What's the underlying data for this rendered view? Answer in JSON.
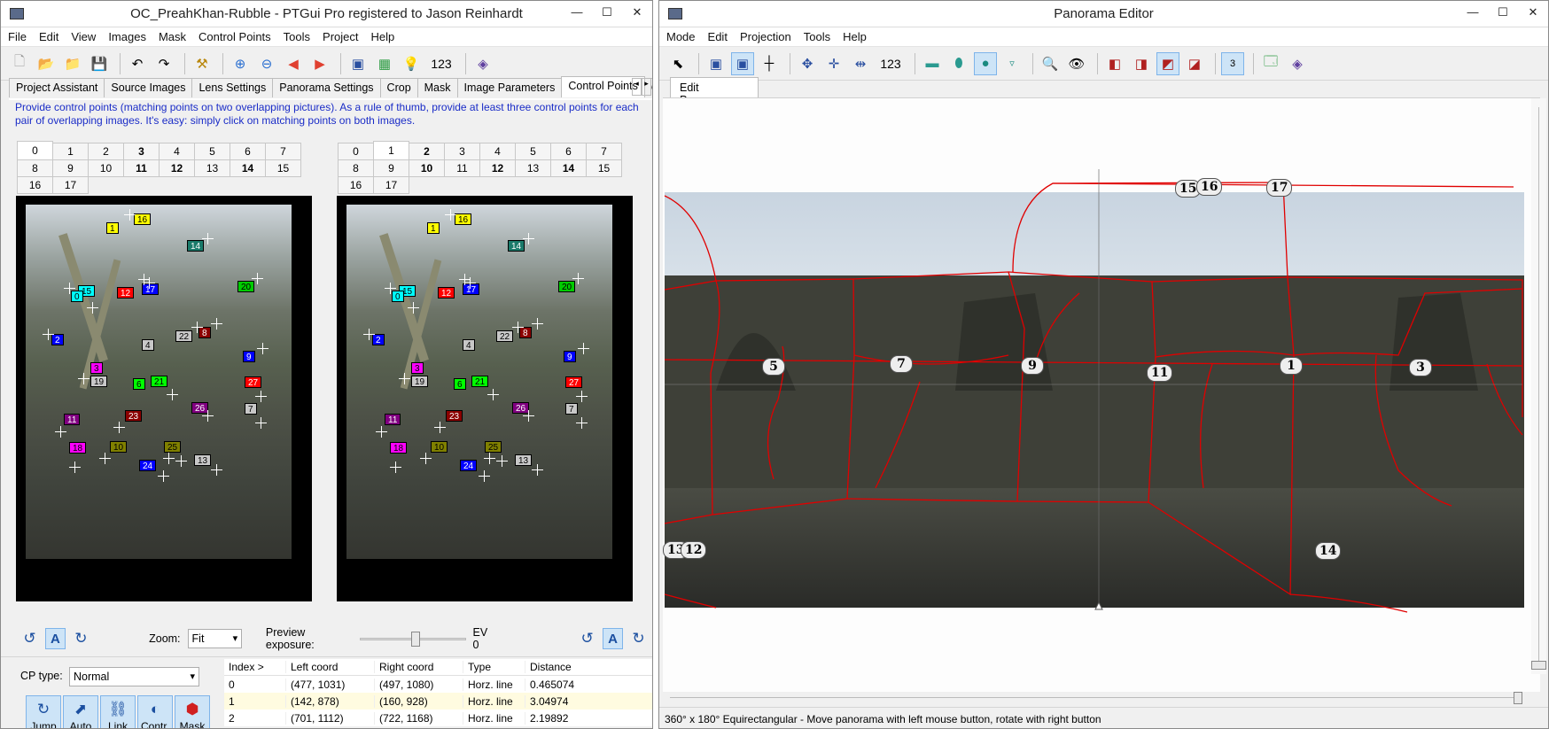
{
  "left_window": {
    "title": "OC_PreahKhan-Rubble - PTGui Pro registered to Jason Reinhardt",
    "menu": [
      "File",
      "Edit",
      "View",
      "Images",
      "Mask",
      "Control Points",
      "Tools",
      "Project",
      "Help"
    ],
    "toolbar_number_label": "123",
    "tabs": [
      "Project Assistant",
      "Source Images",
      "Lens Settings",
      "Panorama Settings",
      "Crop",
      "Mask",
      "Image Parameters",
      "Control Points",
      "O"
    ],
    "active_tab": "Control Points",
    "info_text": "Provide control points (matching points on two overlapping pictures). As a rule of thumb, provide at least three control points for each pair of overlapping images. It's easy: simply click on matching points on both images.",
    "left_image_numbers": [
      "0",
      "1",
      "2",
      "3",
      "4",
      "5",
      "6",
      "7",
      "8",
      "9",
      "10",
      "11",
      "12",
      "13",
      "14",
      "15",
      "16",
      "17"
    ],
    "left_selected": "0",
    "left_bold": [
      "3",
      "11",
      "12",
      "14"
    ],
    "right_image_numbers": [
      "0",
      "1",
      "2",
      "3",
      "4",
      "5",
      "6",
      "7",
      "8",
      "9",
      "10",
      "11",
      "12",
      "13",
      "14",
      "15",
      "16",
      "17"
    ],
    "right_selected": "1",
    "right_bold": [
      "2",
      "10",
      "12",
      "14"
    ],
    "control_points": [
      {
        "label": "1",
        "color": "#ffff00"
      },
      {
        "label": "16",
        "color": "#ffff00"
      },
      {
        "label": "14",
        "color": "#1a7a6a"
      },
      {
        "label": "15",
        "color": "#00ffff"
      },
      {
        "label": "0",
        "color": "#00ffff"
      },
      {
        "label": "12",
        "color": "#ff0000"
      },
      {
        "label": "17",
        "color": "#0000ff"
      },
      {
        "label": "20",
        "color": "#00cc00"
      },
      {
        "label": "2",
        "color": "#0000ff"
      },
      {
        "label": "22",
        "color": "#c8c8c8"
      },
      {
        "label": "8",
        "color": "#8b0000"
      },
      {
        "label": "4",
        "color": "#c8c8c8"
      },
      {
        "label": "9",
        "color": "#0000ff"
      },
      {
        "label": "3",
        "color": "#ff00ff"
      },
      {
        "label": "19",
        "color": "#c8c8c8"
      },
      {
        "label": "6",
        "color": "#00ff00"
      },
      {
        "label": "21",
        "color": "#00ff00"
      },
      {
        "label": "27",
        "color": "#ff0000"
      },
      {
        "label": "26",
        "color": "#800080"
      },
      {
        "label": "7",
        "color": "#c8c8c8"
      },
      {
        "label": "23",
        "color": "#8b0000"
      },
      {
        "label": "11",
        "color": "#800080"
      },
      {
        "label": "18",
        "color": "#ff00ff"
      },
      {
        "label": "10",
        "color": "#808000"
      },
      {
        "label": "25",
        "color": "#808000"
      },
      {
        "label": "13",
        "color": "#c8c8c8"
      },
      {
        "label": "24",
        "color": "#0000ff"
      }
    ],
    "zoom_label": "Zoom:",
    "zoom_value": "Fit",
    "preview_exposure_label": "Preview exposure:",
    "preview_exposure_value": "EV 0",
    "cp_type_label": "CP type:",
    "cp_type_value": "Normal",
    "action_buttons": [
      "Jump",
      "Auto",
      "Link",
      "Contr.",
      "Mask"
    ],
    "table": {
      "headers": [
        "Index >",
        "Left coord",
        "Right coord",
        "Type",
        "Distance"
      ],
      "rows": [
        [
          "0",
          "(477, 1031)",
          "(497, 1080)",
          "Horz. line",
          "0.465074"
        ],
        [
          "1",
          "(142, 878)",
          "(160, 928)",
          "Horz. line",
          "3.04974"
        ],
        [
          "2",
          "(701, 1112)",
          "(722, 1168)",
          "Horz. line",
          "2.19892"
        ]
      ]
    }
  },
  "right_window": {
    "title": "Panorama Editor",
    "menu": [
      "Mode",
      "Edit",
      "Projection",
      "Tools",
      "Help"
    ],
    "toolbar_number_label": "123",
    "toolbar_badge": "3",
    "tab": "Edit Panorama",
    "image_labels": [
      "15",
      "16",
      "17",
      "5",
      "7",
      "9",
      "11",
      "1",
      "3",
      "13",
      "12",
      "14"
    ],
    "status": "360° x 180° Equirectangular - Move panorama with left mouse button, rotate with right button"
  }
}
